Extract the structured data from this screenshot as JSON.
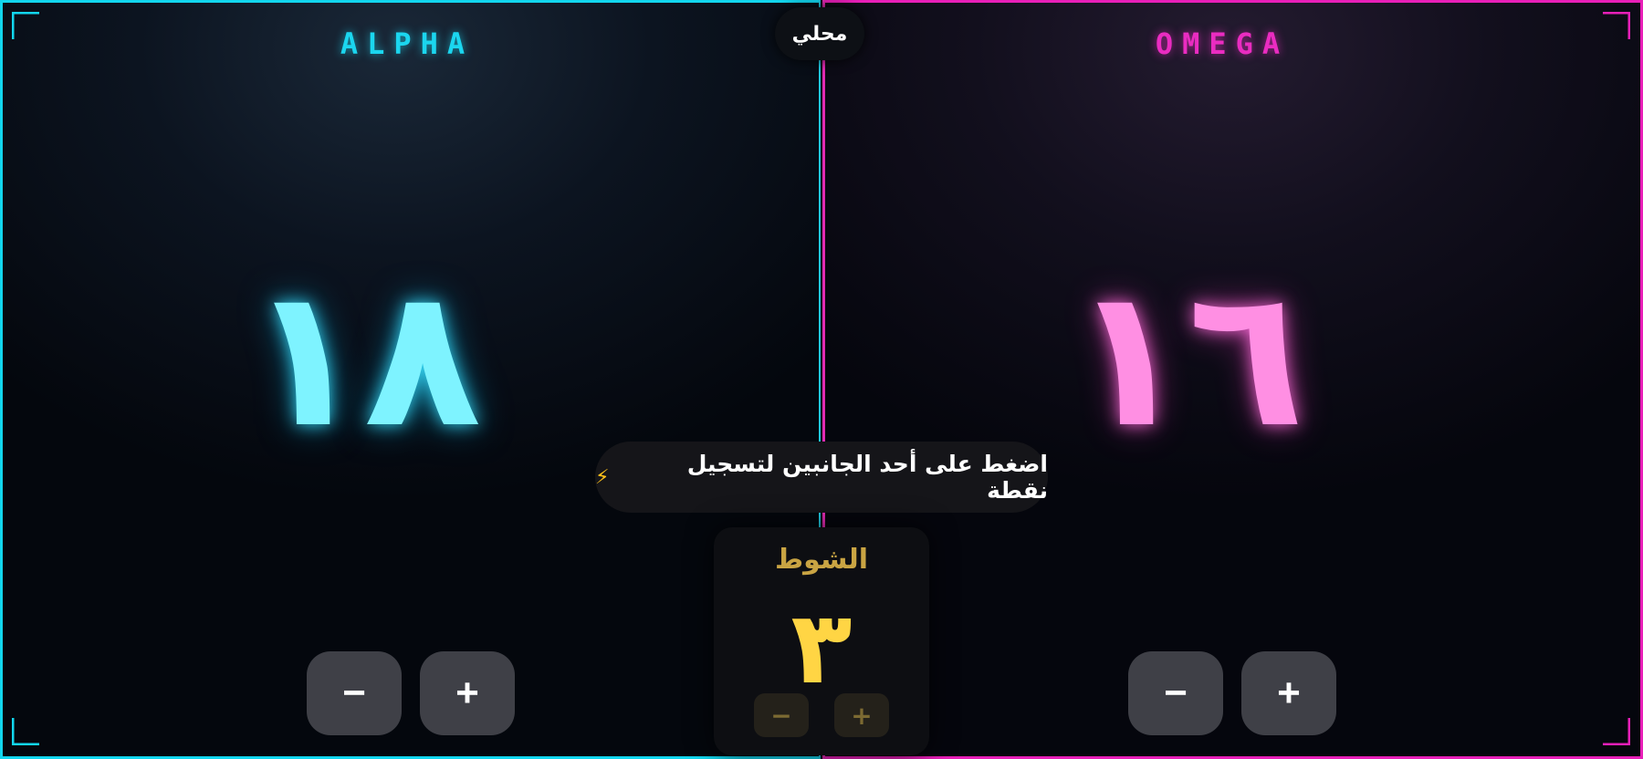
{
  "mode_label": "محلي",
  "hint": {
    "text": "اضغط على أحد الجانبين لتسجيل نقطة",
    "icon": "lightning-icon"
  },
  "left_team": {
    "name": "ALPHA",
    "score": "١٨",
    "minus": "−",
    "plus": "+",
    "color": "#12d6ee"
  },
  "right_team": {
    "name": "OMEGA",
    "score": "١٦",
    "minus": "−",
    "plus": "+",
    "color": "#e81fb8"
  },
  "round": {
    "label": "الشوط",
    "value": "٣",
    "minus": "−",
    "plus": "+",
    "color": "#ffd544"
  }
}
